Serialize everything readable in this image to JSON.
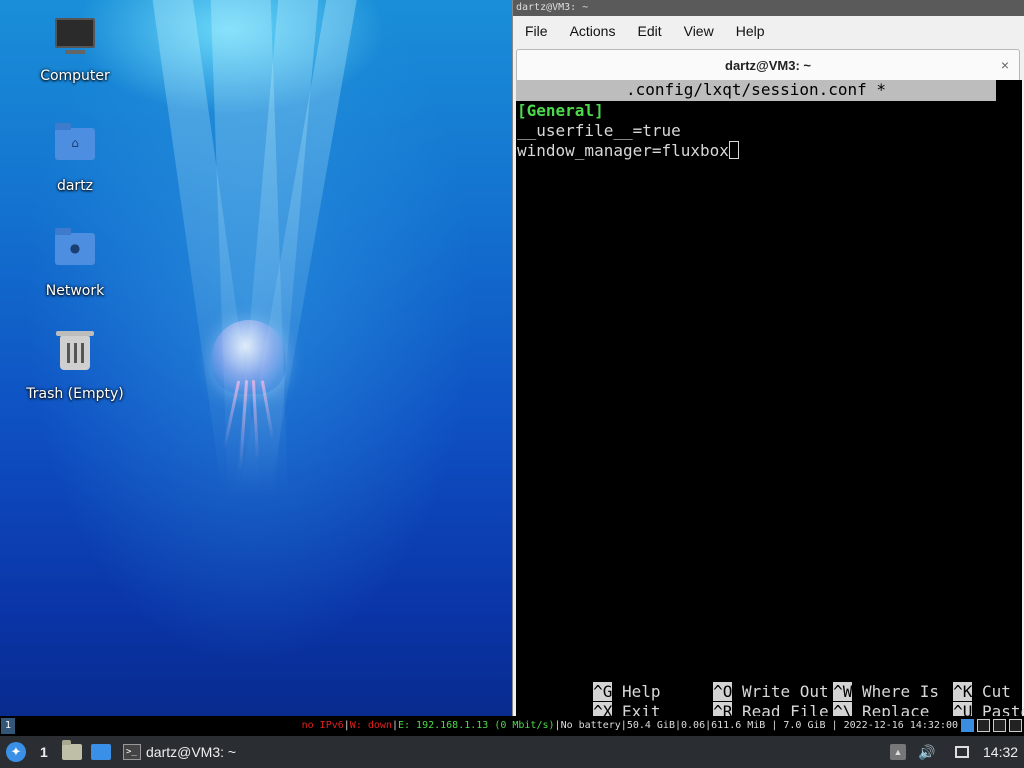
{
  "desktop": {
    "icons": [
      {
        "label": "Computer",
        "icon": "computer-icon"
      },
      {
        "label": "dartz",
        "icon": "home-folder-icon"
      },
      {
        "label": "Network",
        "icon": "network-folder-icon"
      },
      {
        "label": "Trash (Empty)",
        "icon": "trash-icon"
      }
    ]
  },
  "terminal": {
    "window_title": "dartz@VM3: ~",
    "menu": [
      "File",
      "Actions",
      "Edit",
      "View",
      "Help"
    ],
    "tab_label": "dartz@VM3: ~",
    "tab_close": "×",
    "nano": {
      "header": ".config/lxqt/session.conf *",
      "lines": [
        "[General]",
        "__userfile__=true",
        "window_manager=fluxbox"
      ],
      "shortcuts": [
        [
          {
            "key": "^G",
            "label": "Help"
          },
          {
            "key": "^O",
            "label": "Write Out"
          },
          {
            "key": "^W",
            "label": "Where Is"
          },
          {
            "key": "^K",
            "label": "Cut"
          }
        ],
        [
          {
            "key": "^X",
            "label": "Exit"
          },
          {
            "key": "^R",
            "label": "Read File"
          },
          {
            "key": "^\\",
            "label": "Replace"
          },
          {
            "key": "^U",
            "label": "Paste"
          }
        ]
      ]
    }
  },
  "statusbar": {
    "workspace": "1",
    "ipv6": "no IPv6",
    "wireless": "W: down",
    "ethernet": "E: 192.168.1.13 (0 Mbit/s)",
    "battery": "No battery",
    "disk": "50.4 GiB",
    "load": "0.06",
    "memory": "611.6 MiB",
    "total_memory": "7.0 GiB",
    "datetime": "2022-12-16 14:32:00",
    "separator": "|"
  },
  "taskbar": {
    "workspace": "1",
    "task_label": "dartz@VM3: ~",
    "clock": "14:32",
    "colors": {
      "background": "#2a2e33",
      "accent": "#3a8fe6"
    }
  }
}
